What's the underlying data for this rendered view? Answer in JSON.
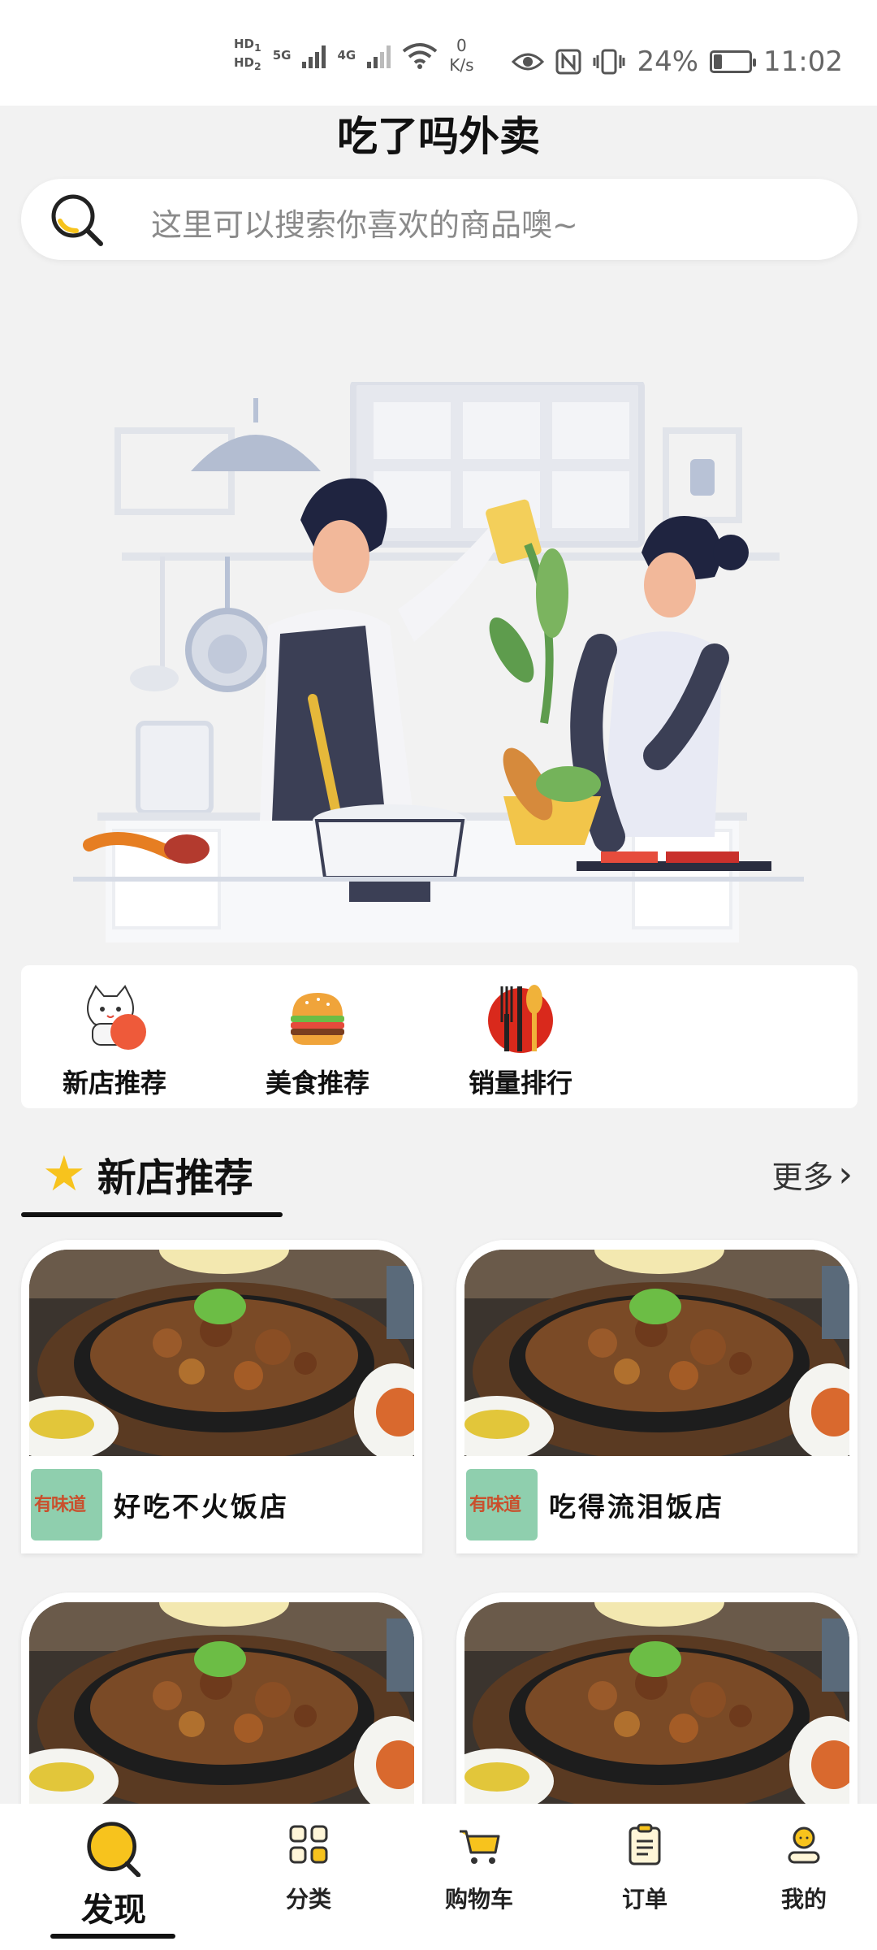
{
  "status_bar": {
    "hd1": "HD",
    "hd2": "HD",
    "sim1": "1",
    "sim2": "2",
    "net1": "5G",
    "net2": "4G",
    "speed_value": "0",
    "speed_unit": "K/s",
    "battery": "24%",
    "battery_level": 0.24,
    "time": "11:02"
  },
  "app": {
    "title": "吃了吗外卖"
  },
  "search": {
    "placeholder": "这里可以搜索你喜欢的商品噢~"
  },
  "categories": [
    {
      "label": "新店推荐",
      "icon": "lucky-cat-icon"
    },
    {
      "label": "美食推荐",
      "icon": "burger-icon"
    },
    {
      "label": "销量排行",
      "icon": "utensils-icon"
    }
  ],
  "section": {
    "title": "新店推荐",
    "more": "更多",
    "icon": "star-icon"
  },
  "shops": [
    {
      "name": "好吃不火饭店",
      "logo_text": "有味道"
    },
    {
      "name": "吃得流泪饭店",
      "logo_text": "有味道"
    },
    {
      "name": "",
      "logo_text": ""
    },
    {
      "name": "",
      "logo_text": ""
    }
  ],
  "tabs": [
    {
      "label": "发现",
      "icon": "discover-icon",
      "active": true
    },
    {
      "label": "分类",
      "icon": "grid-icon"
    },
    {
      "label": "购物车",
      "icon": "cart-icon"
    },
    {
      "label": "订单",
      "icon": "clipboard-icon"
    },
    {
      "label": "我的",
      "icon": "user-icon"
    }
  ],
  "colors": {
    "accent": "#f7c31d",
    "background": "#f2f2f2",
    "logo_bg": "#8fcfae"
  }
}
